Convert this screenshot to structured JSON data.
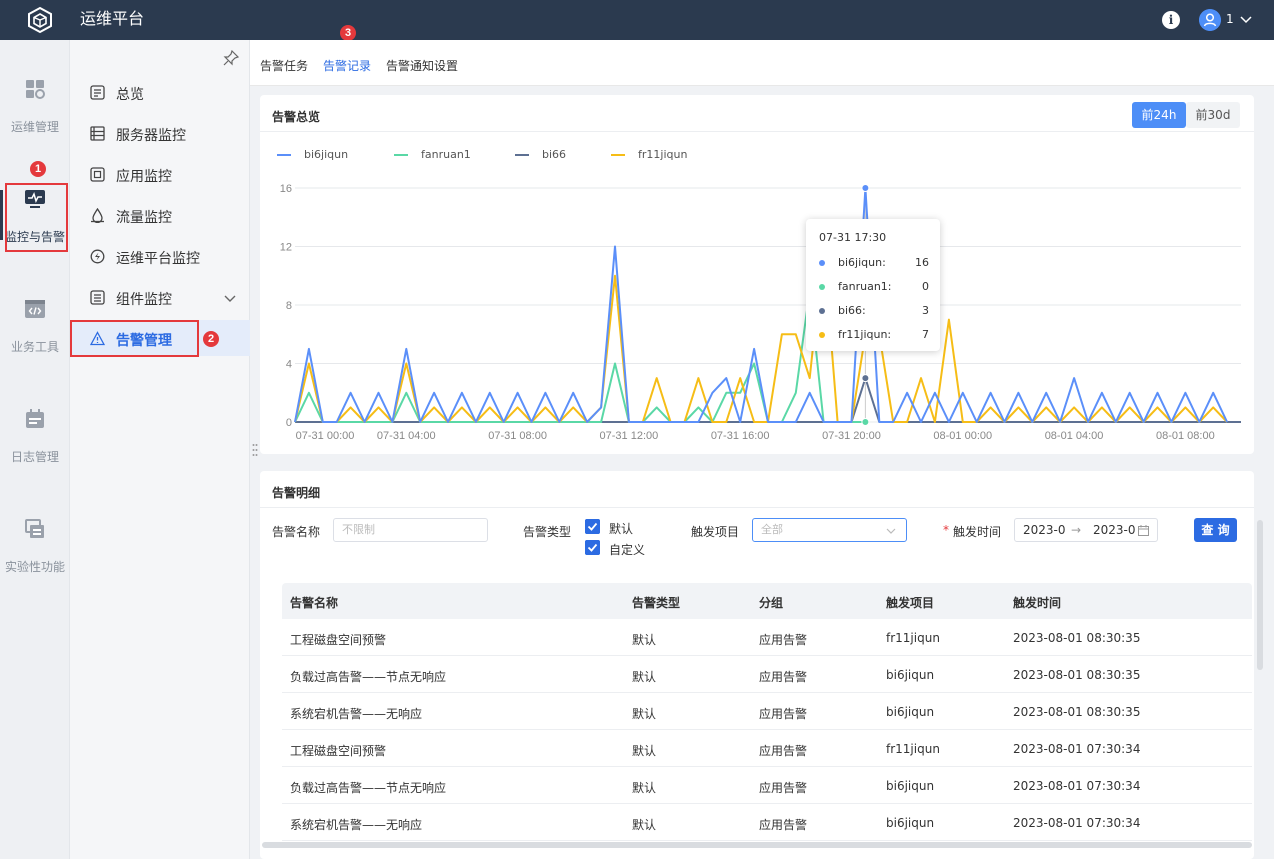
{
  "header": {
    "title": "运维平台",
    "user": "1"
  },
  "rail": [
    {
      "label": "运维管理",
      "icon": "dashboard-grid-icon"
    },
    {
      "label": "监控与告警",
      "icon": "monitor-icon"
    },
    {
      "label": "业务工具",
      "icon": "code-icon"
    },
    {
      "label": "日志管理",
      "icon": "calendar-icon"
    },
    {
      "label": "实验性功能",
      "icon": "layers-icon"
    }
  ],
  "subnav": [
    {
      "label": "总览",
      "icon": "overview-icon"
    },
    {
      "label": "服务器监控",
      "icon": "server-icon"
    },
    {
      "label": "应用监控",
      "icon": "app-icon"
    },
    {
      "label": "流量监控",
      "icon": "traffic-icon"
    },
    {
      "label": "运维平台监控",
      "icon": "platform-icon"
    },
    {
      "label": "组件监控",
      "icon": "component-icon"
    },
    {
      "label": "告警管理",
      "icon": "warning-icon"
    }
  ],
  "annotations": {
    "a1": "1",
    "a2": "2",
    "a3": "3"
  },
  "tabs": [
    "告警任务",
    "告警记录",
    "告警通知设置"
  ],
  "overview": {
    "title": "告警总览",
    "btn_24h": "前24h",
    "btn_30d": "前30d"
  },
  "chart_data": {
    "type": "line",
    "ylim": [
      0,
      16
    ],
    "yticks": [
      "0",
      "4",
      "8",
      "12",
      "16"
    ],
    "xticks": [
      "07-31 00:00",
      "07-31 04:00",
      "07-31 08:00",
      "07-31 12:00",
      "07-31 16:00",
      "07-31 20:00",
      "08-01 00:00",
      "08-01 04:00",
      "08-01 08:00"
    ],
    "x_hours_span": [
      0,
      34
    ],
    "series": [
      {
        "name": "bi6jiqun",
        "color": "#5b8ff9",
        "points": [
          [
            0,
            0
          ],
          [
            0.5,
            5
          ],
          [
            1,
            0
          ],
          [
            1.5,
            0
          ],
          [
            2,
            2
          ],
          [
            2.5,
            0
          ],
          [
            3,
            2
          ],
          [
            3.5,
            0
          ],
          [
            4,
            5
          ],
          [
            4.5,
            0
          ],
          [
            5,
            2
          ],
          [
            5.5,
            0
          ],
          [
            6,
            2
          ],
          [
            6.5,
            0
          ],
          [
            7,
            2
          ],
          [
            7.5,
            0
          ],
          [
            8,
            2
          ],
          [
            8.5,
            0
          ],
          [
            9,
            2
          ],
          [
            9.5,
            0
          ],
          [
            10,
            2
          ],
          [
            10.5,
            0
          ],
          [
            11,
            1
          ],
          [
            11.5,
            12
          ],
          [
            12,
            0
          ],
          [
            14.5,
            0
          ],
          [
            15,
            2
          ],
          [
            15.5,
            3
          ],
          [
            16,
            0
          ],
          [
            16.5,
            5
          ],
          [
            17,
            0
          ],
          [
            18,
            0
          ],
          [
            18.5,
            2
          ],
          [
            19,
            0
          ],
          [
            20,
            0
          ],
          [
            20.5,
            16
          ],
          [
            21,
            0
          ],
          [
            21.5,
            0
          ],
          [
            22,
            2
          ],
          [
            22.5,
            0
          ],
          [
            23,
            2
          ],
          [
            23.5,
            0
          ],
          [
            24,
            2
          ],
          [
            24.5,
            0
          ],
          [
            25,
            2
          ],
          [
            25.5,
            0
          ],
          [
            26,
            2
          ],
          [
            26.5,
            0
          ],
          [
            27,
            2
          ],
          [
            27.5,
            0
          ],
          [
            28,
            3
          ],
          [
            28.5,
            0
          ],
          [
            29,
            2
          ],
          [
            29.5,
            0
          ],
          [
            30,
            2
          ],
          [
            30.5,
            0
          ],
          [
            31,
            2
          ],
          [
            31.5,
            0
          ],
          [
            32,
            2
          ],
          [
            32.5,
            0
          ],
          [
            33,
            2
          ],
          [
            33.5,
            0
          ]
        ]
      },
      {
        "name": "fanruan1",
        "color": "#5ad8a6",
        "points": [
          [
            0,
            0
          ],
          [
            0.5,
            2
          ],
          [
            1,
            0
          ],
          [
            3.5,
            0
          ],
          [
            4,
            2
          ],
          [
            4.5,
            0
          ],
          [
            11,
            0
          ],
          [
            11.5,
            4
          ],
          [
            12,
            0
          ],
          [
            12.5,
            0
          ],
          [
            13,
            1
          ],
          [
            13.5,
            0
          ],
          [
            14,
            0
          ],
          [
            14.5,
            1
          ],
          [
            15,
            0
          ],
          [
            15.5,
            2
          ],
          [
            16,
            2
          ],
          [
            16.5,
            4
          ],
          [
            17,
            0
          ],
          [
            17.5,
            0
          ],
          [
            18,
            2
          ],
          [
            18.5,
            9
          ],
          [
            19,
            0
          ],
          [
            20.5,
            0
          ]
        ]
      },
      {
        "name": "bi66",
        "color": "#5d7092",
        "points": [
          [
            0,
            0
          ],
          [
            20,
            0
          ],
          [
            20.5,
            3
          ],
          [
            21,
            0
          ],
          [
            34,
            0
          ]
        ]
      },
      {
        "name": "fr11jiqun",
        "color": "#f6bd16",
        "points": [
          [
            0,
            0
          ],
          [
            0.5,
            4
          ],
          [
            1,
            0
          ],
          [
            1.5,
            0
          ],
          [
            2,
            1
          ],
          [
            2.5,
            0
          ],
          [
            3,
            1
          ],
          [
            3.5,
            0
          ],
          [
            4,
            4
          ],
          [
            4.5,
            0
          ],
          [
            5,
            1
          ],
          [
            5.5,
            0
          ],
          [
            6,
            1
          ],
          [
            6.5,
            0
          ],
          [
            7,
            1
          ],
          [
            7.5,
            0
          ],
          [
            8,
            1
          ],
          [
            8.5,
            0
          ],
          [
            9,
            1
          ],
          [
            9.5,
            0
          ],
          [
            10,
            1
          ],
          [
            10.5,
            0
          ],
          [
            11,
            1
          ],
          [
            11.5,
            10
          ],
          [
            12,
            0
          ],
          [
            12.5,
            0
          ],
          [
            13,
            3
          ],
          [
            13.5,
            0
          ],
          [
            14,
            0
          ],
          [
            14.5,
            3
          ],
          [
            15,
            0
          ],
          [
            15.5,
            0
          ],
          [
            16,
            3
          ],
          [
            16.5,
            0
          ],
          [
            17,
            0
          ],
          [
            17.5,
            6
          ],
          [
            18,
            6
          ],
          [
            18.5,
            3
          ],
          [
            19,
            12
          ],
          [
            19.5,
            0
          ],
          [
            20,
            0
          ],
          [
            20.5,
            6
          ],
          [
            21,
            6
          ],
          [
            21.5,
            0
          ],
          [
            22,
            0
          ],
          [
            22.5,
            3
          ],
          [
            23,
            0
          ],
          [
            23.5,
            7
          ],
          [
            24,
            0
          ],
          [
            24.5,
            0
          ],
          [
            25,
            1
          ],
          [
            25.5,
            0
          ],
          [
            26,
            1
          ],
          [
            26.5,
            0
          ],
          [
            27,
            1
          ],
          [
            27.5,
            0
          ],
          [
            28,
            1
          ],
          [
            28.5,
            0
          ],
          [
            29,
            1
          ],
          [
            29.5,
            0
          ],
          [
            30,
            1
          ],
          [
            30.5,
            0
          ],
          [
            31,
            1
          ],
          [
            31.5,
            0
          ],
          [
            32,
            1
          ],
          [
            32.5,
            0
          ],
          [
            33,
            1
          ],
          [
            33.5,
            0
          ]
        ]
      }
    ],
    "highlight_x": 20.5
  },
  "tooltip": {
    "time": "07-31 17:30",
    "rows": [
      {
        "name": "bi6jiqun:",
        "value": "16",
        "color": "#5b8ff9"
      },
      {
        "name": "fanruan1:",
        "value": "0",
        "color": "#5ad8a6"
      },
      {
        "name": "bi66:",
        "value": "3",
        "color": "#5d7092"
      },
      {
        "name": "fr11jiqun:",
        "value": "7",
        "color": "#f6bd16"
      }
    ]
  },
  "detail": {
    "title": "告警明细",
    "filters": {
      "name_label": "告警名称",
      "name_placeholder": "不限制",
      "type_label": "告警类型",
      "type_default": "默认",
      "type_custom": "自定义",
      "project_label": "触发项目",
      "project_placeholder": "全部",
      "time_label": "触发时间",
      "time_required": "*",
      "time_start": "2023-0",
      "time_arrow": "→",
      "time_end": "2023-0",
      "query": "查 询"
    },
    "columns": [
      "告警名称",
      "告警类型",
      "分组",
      "触发项目",
      "触发时间"
    ],
    "rows": [
      [
        "工程磁盘空间预警",
        "默认",
        "应用告警",
        "fr11jiqun",
        "2023-08-01 08:30:35"
      ],
      [
        "负载过高告警——节点无响应",
        "默认",
        "应用告警",
        "bi6jiqun",
        "2023-08-01 08:30:35"
      ],
      [
        "系统宕机告警——无响应",
        "默认",
        "应用告警",
        "bi6jiqun",
        "2023-08-01 08:30:35"
      ],
      [
        "工程磁盘空间预警",
        "默认",
        "应用告警",
        "fr11jiqun",
        "2023-08-01 07:30:34"
      ],
      [
        "负载过高告警——节点无响应",
        "默认",
        "应用告警",
        "bi6jiqun",
        "2023-08-01 07:30:34"
      ],
      [
        "系统宕机告警——无响应",
        "默认",
        "应用告警",
        "bi6jiqun",
        "2023-08-01 07:30:34"
      ]
    ]
  }
}
